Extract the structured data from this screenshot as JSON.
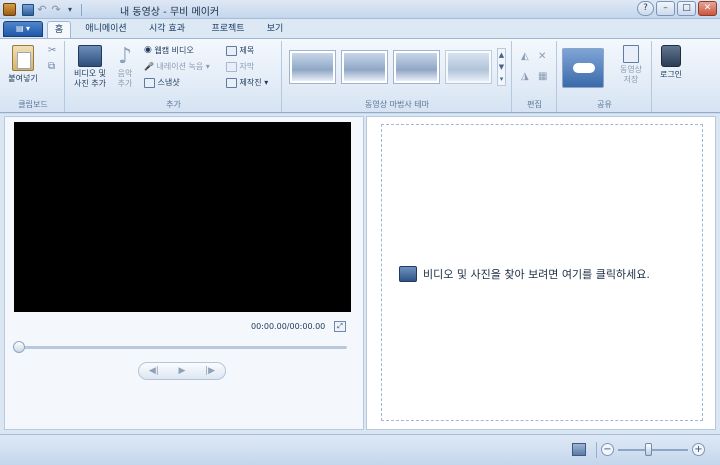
{
  "window": {
    "title": "내 동영상 - 무비 메이커",
    "buttons": {
      "help": "?",
      "minimize": "–",
      "maximize": "□",
      "close": "✕"
    }
  },
  "quick_access": {
    "undo": "↶",
    "redo": "↷",
    "dropdown": "▾"
  },
  "file_menu": {
    "label": "▤ ▾"
  },
  "tabs": [
    {
      "label": "홈",
      "active": true
    },
    {
      "label": "애니메이션"
    },
    {
      "label": "시각 효과"
    },
    {
      "label": "프로젝트"
    },
    {
      "label": "보기"
    }
  ],
  "ribbon": {
    "clipboard": {
      "paste": "붙여넣기",
      "group_label": "클립보드"
    },
    "add": {
      "add_videos_line1": "비디오 및",
      "add_videos_line2": "사진 추가",
      "music_line1": "음악",
      "music_line2": "추가",
      "webcam": "웹캠 비디오",
      "narration": "내레이션 녹음",
      "snapshot": "스냅샷",
      "title": "제목",
      "caption": "자막",
      "credits": "제작진",
      "group_label": "추가"
    },
    "themes": {
      "group_label": "동영상 마법사 테마"
    },
    "editing": {
      "group_label": "편집"
    },
    "share": {
      "save_line1": "동영상",
      "save_line2": "저장",
      "group_label": "공유"
    },
    "login": {
      "label": "로그인"
    }
  },
  "player": {
    "timecode": "00:00.00/00:00.00",
    "prev_frame": "◀|",
    "play": "▶",
    "next_frame": "|▶",
    "seek_position": 0
  },
  "storyboard": {
    "message": "비디오 및 사진을 찾아 보려면 여기를 클릭하세요."
  },
  "statusbar": {
    "zoom_out": "−",
    "zoom_in": "+",
    "zoom_level": 0.43
  }
}
